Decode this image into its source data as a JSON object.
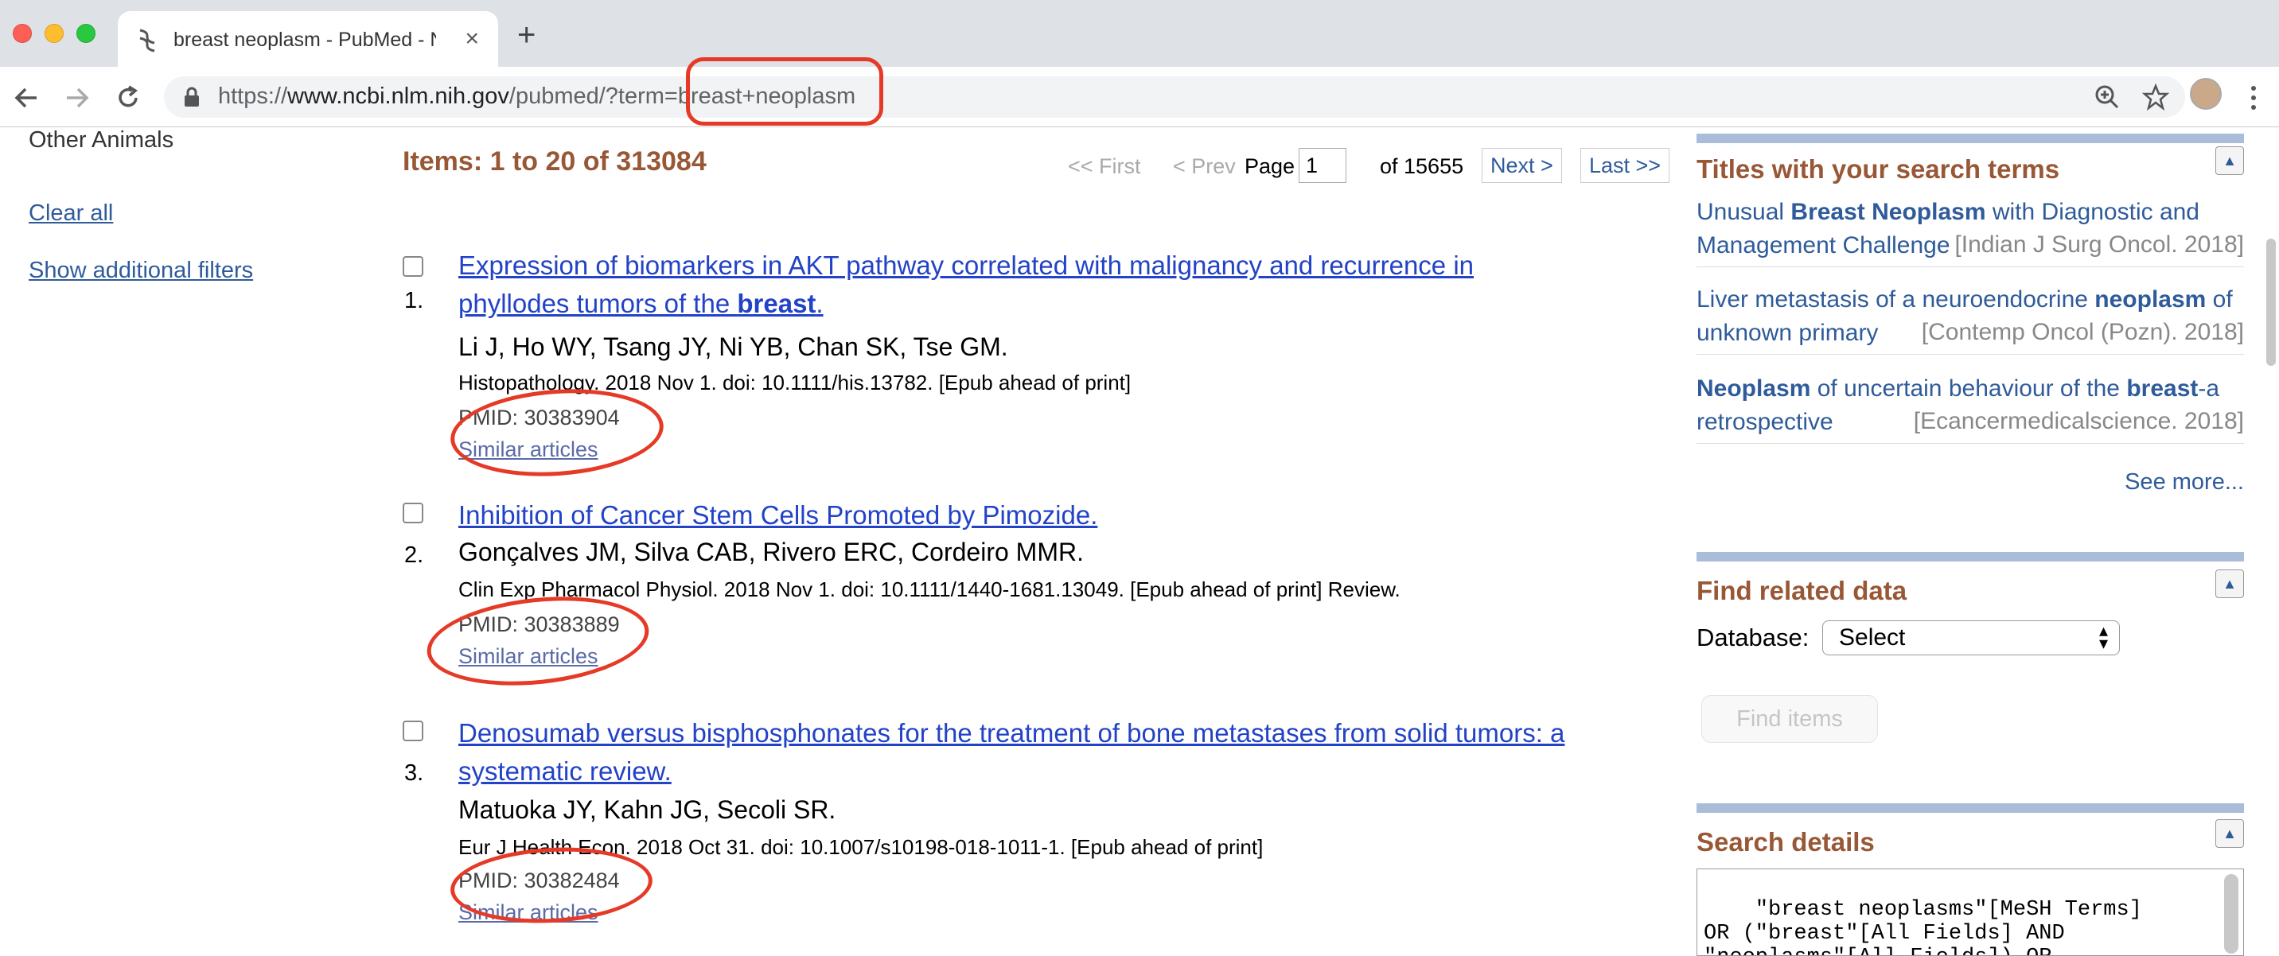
{
  "browser": {
    "tab_title": "breast neoplasm - PubMed - NCBI",
    "tab_close": "×",
    "new_tab": "+",
    "url_scheme": "https://",
    "url_host": "www.ncbi.nlm.nih.gov",
    "url_path": "/pubmed/?term=",
    "url_query": "breast+neoplasm"
  },
  "sidebar": {
    "other_animals": "Other Animals",
    "clear_all": "Clear all",
    "show_filters": "Show additional filters"
  },
  "results_header": {
    "items": "Items: 1 to 20 of 313084",
    "first": "<< First",
    "prev": "< Prev",
    "page_label": "Page",
    "page_value": "1",
    "of_pages": "of 15655",
    "next": "Next >",
    "last": "Last >>"
  },
  "results": [
    {
      "num": "1.",
      "title_l1": "Expression of biomarkers in AKT pathway correlated with malignancy and recurrence in",
      "title_l2_pre": "phyllodes tumors of the ",
      "title_l2_bold": "breast",
      "title_l2_post": ".",
      "authors": "Li J, Ho WY, Tsang JY, Ni YB, Chan SK, Tse GM.",
      "journal": "Histopathology. 2018 Nov 1. doi: 10.1111/his.13782. [Epub ahead of print]",
      "pmid": "PMID: 30383904",
      "similar": "Similar articles"
    },
    {
      "num": "2.",
      "title_l1": "Inhibition of Cancer Stem Cells Promoted by Pimozide.",
      "authors": "Gonçalves JM, Silva CAB, Rivero ERC, Cordeiro MMR.",
      "journal": "Clin Exp Pharmacol Physiol. 2018 Nov 1. doi: 10.1111/1440-1681.13049. [Epub ahead of print] Review.",
      "pmid": "PMID: 30383889",
      "similar": "Similar articles"
    },
    {
      "num": "3.",
      "title_l1": "Denosumab versus bisphosphonates for the treatment of bone metastases from solid tumors: a",
      "title_l2": "systematic review.",
      "authors": "Matuoka JY, Kahn JG, Secoli SR.",
      "journal": "Eur J Health Econ. 2018 Oct 31. doi: 10.1007/s10198-018-1011-1. [Epub ahead of print]",
      "pmid": "PMID: 30382484",
      "similar": "Similar articles"
    }
  ],
  "right": {
    "titles_header": "Titles with your search terms",
    "titles": [
      {
        "a": "Unusual ",
        "b": "Breast Neoplasm",
        "c": " with Diagnostic and Management Challenges",
        "src": "[Indian J Surg Oncol. 2018]"
      },
      {
        "a": "Liver metastasis of a neuroendocrine ",
        "b": "neoplasm",
        "c": " of unknown primary",
        "src": "[Contemp Oncol (Pozn). 2018]"
      },
      {
        "a": "",
        "b": "Neoplasm",
        "c": " of uncertain behaviour of the ",
        "d": "breast",
        "e": "-a retrospective",
        "src": "[Ecancermedicalscience. 2018]"
      }
    ],
    "see_more": "See more...",
    "related_header": "Find related data",
    "database_label": "Database:",
    "database_value": "Select",
    "find_items": "Find items",
    "details_header": "Search details",
    "details_text": "\"breast neoplasms\"[MeSH Terms]\nOR (\"breast\"[All Fields] AND\n\"neoplasms\"[All Fields]) OR"
  },
  "annotation_color": "#e53a26",
  "link_color": "#2242c7"
}
